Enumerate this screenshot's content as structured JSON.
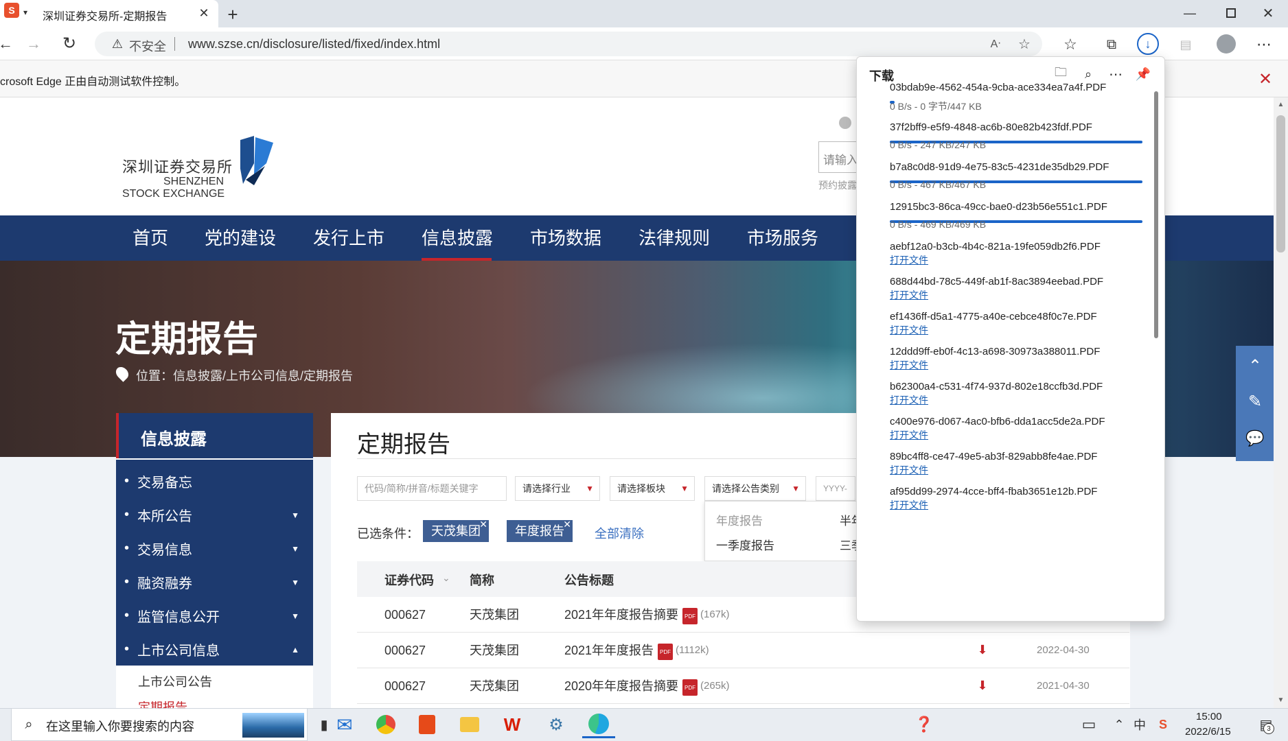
{
  "browser": {
    "tab_title": "深圳证券交易所-定期报告",
    "security_label": "不安全",
    "url": "www.szse.cn/disclosure/listed/fixed/index.html",
    "infobar_text": "crosoft Edge 正由自动测试软件控制。"
  },
  "site": {
    "logo_cn": "深圳证券交易所",
    "logo_en1": "SHENZHEN",
    "logo_en2": "STOCK EXCHANGE",
    "search_placeholder": "请输入",
    "search_hint": "预约披露",
    "nav": [
      "首页",
      "党的建设",
      "发行上市",
      "信息披露",
      "市场数据",
      "法律规则",
      "市场服务"
    ],
    "banner_title": "定期报告",
    "breadcrumb": "位置：信息披露/上市公司信息/定期报告"
  },
  "sidebar": {
    "title": "信息披露",
    "items": [
      "交易备忘",
      "本所公告",
      "交易信息",
      "融资融券",
      "监管信息公开",
      "上市公司信息"
    ],
    "sub_item": "上市公司公告",
    "sub_item_partial": "定期报告"
  },
  "content": {
    "title": "定期报告",
    "keyword_placeholder": "代码/简称/拼音/标题关键字",
    "filters": [
      "请选择行业",
      "请选择板块",
      "请选择公告类别"
    ],
    "date_placeholder": "YYYY-",
    "selected_label": "已选条件：",
    "selected_tags": [
      "天茂集团",
      "年度报告"
    ],
    "clear_all": "全部清除",
    "dropdown_items": [
      "年度报告",
      "半年",
      "一季度报告",
      "三季"
    ],
    "table_headers": [
      "证券代码",
      "简称",
      "公告标题"
    ],
    "rows": [
      {
        "code": "000627",
        "name": "天茂集团",
        "title": "2021年年度报告摘要",
        "size": "(167k)",
        "date": ""
      },
      {
        "code": "000627",
        "name": "天茂集团",
        "title": "2021年年度报告",
        "size": "(1112k)",
        "date": "2022-04-30"
      },
      {
        "code": "000627",
        "name": "天茂集团",
        "title": "2020年年度报告摘要",
        "size": "(265k)",
        "date": "2021-04-30"
      }
    ]
  },
  "downloads": {
    "title": "下载",
    "items": [
      {
        "name": "03bdab9e-4562-454a-9cba-ace334ea7a4f.PDF",
        "status": "0 B/s - 0 字节/447 KB",
        "progress": 0.02
      },
      {
        "name": "37f2bff9-e5f9-4848-ac6b-80e82b423fdf.PDF",
        "status": "0 B/s - 247 KB/247 KB",
        "progress": 1
      },
      {
        "name": "b7a8c0d8-91d9-4e75-83c5-4231de35db29.PDF",
        "status": "0 B/s - 467 KB/467 KB",
        "progress": 1
      },
      {
        "name": "12915bc3-86ca-49cc-bae0-d23b56e551c1.PDF",
        "status": "0 B/s - 469 KB/469 KB",
        "progress": 1
      },
      {
        "name": "aebf12a0-b3cb-4b4c-821a-19fe059db2f6.PDF",
        "link": "打开文件"
      },
      {
        "name": "688d44bd-78c5-449f-ab1f-8ac3894eebad.PDF",
        "link": "打开文件"
      },
      {
        "name": "ef1436ff-d5a1-4775-a40e-cebce48f0c7e.PDF",
        "link": "打开文件"
      },
      {
        "name": "12ddd9ff-eb0f-4c13-a698-30973a388011.PDF",
        "link": "打开文件"
      },
      {
        "name": "b62300a4-c531-4f74-937d-802e18ccfb3d.PDF",
        "link": "打开文件"
      },
      {
        "name": "c400e976-d067-4ac0-bfb6-dda1acc5de2a.PDF",
        "link": "打开文件"
      },
      {
        "name": "89bc4ff8-ce47-49e5-ab3f-829abb8fe4ae.PDF",
        "link": "打开文件"
      },
      {
        "name": "af95dd99-2974-4cce-bff4-fbab3651e12b.PDF",
        "link": "打开文件"
      }
    ]
  },
  "taskbar": {
    "search_placeholder": "在这里输入你要搜索的内容",
    "time": "15:00",
    "date": "2022/6/15",
    "ime": "中",
    "notification_count": "3"
  },
  "colors": {
    "nav": "#1d3a6f",
    "accent_red": "#c6252b",
    "tag": "#3e5e93",
    "link": "#1a5fb4"
  }
}
